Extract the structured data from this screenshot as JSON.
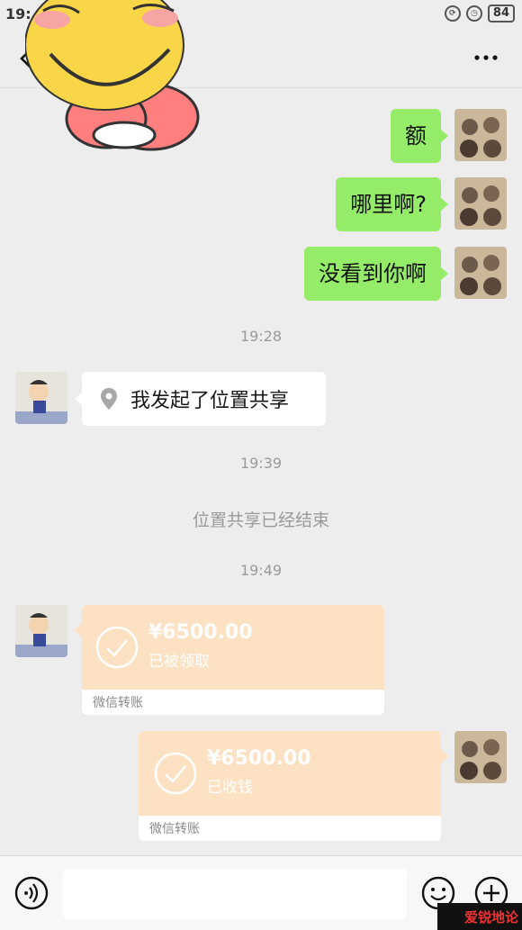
{
  "status_bar": {
    "time": "19:",
    "battery": "84"
  },
  "messages_out": [
    {
      "text": "额"
    },
    {
      "text": "哪里啊?"
    },
    {
      "text": "没看到你啊"
    }
  ],
  "timestamps": [
    "19:28",
    "19:39",
    "19:49"
  ],
  "location_share": {
    "text": "我发起了位置共享"
  },
  "system_notice": "位置共享已经结束",
  "transfers": [
    {
      "amount": "¥6500.00",
      "status": "已被领取",
      "label": "微信转账"
    },
    {
      "amount": "¥6500.00",
      "status": "已收钱",
      "label": "微信转账"
    }
  ],
  "watermark": {
    "text": "爱锐地论"
  },
  "colors": {
    "outgoing_bubble": "#95ec69",
    "transfer_bg": "#fde1c3",
    "background": "#ededed"
  }
}
